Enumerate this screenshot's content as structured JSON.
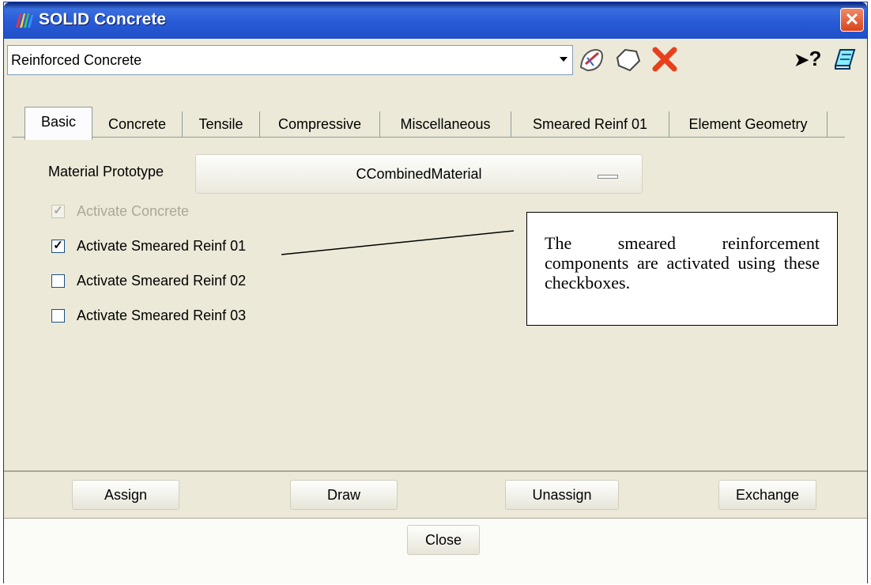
{
  "window": {
    "title": "SOLID Concrete",
    "close_glyph": "✕"
  },
  "toolbar": {
    "combo_value": "Reinforced Concrete",
    "icons": [
      "edit-material-icon",
      "new-material-icon",
      "delete-icon",
      "context-help-icon",
      "notes-icon"
    ],
    "help_glyph": "?"
  },
  "tabs": [
    "Basic",
    "Concrete",
    "Tensile",
    "Compressive",
    "Miscellaneous",
    "Smeared Reinf 01",
    "Element Geometry"
  ],
  "basic": {
    "prototype_label": "Material Prototype",
    "prototype_value": "CCombinedMaterial",
    "checkboxes": [
      {
        "label": "Activate Concrete",
        "checked": true,
        "disabled": true
      },
      {
        "label": "Activate Smeared Reinf 01",
        "checked": true,
        "disabled": false
      },
      {
        "label": "Activate Smeared Reinf 02",
        "checked": false,
        "disabled": false
      },
      {
        "label": "Activate Smeared Reinf 03",
        "checked": false,
        "disabled": false
      }
    ]
  },
  "callout": {
    "text": "The smeared reinforcement components are activated using these checkboxes."
  },
  "buttons": {
    "assign": "Assign",
    "draw": "Draw",
    "unassign": "Unassign",
    "exchange": "Exchange",
    "close": "Close"
  },
  "colors": {
    "title_bar": "#2a5cd8",
    "dialog_bg": "#ece9d8",
    "close_red": "#d8431c"
  }
}
